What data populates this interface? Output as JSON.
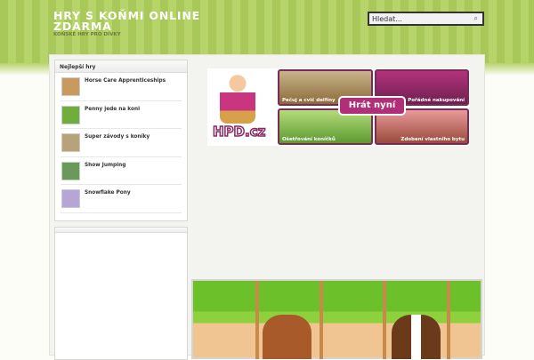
{
  "header": {
    "title": "HRY S KOŇMI ONLINE ZDARMA",
    "tagline": "KOŇSKÉ HRY PRO DÍVKY",
    "search_placeholder": "Hledat...",
    "search_icon": "search-icon"
  },
  "sidebar": {
    "widget_title": "Nejlepší hry",
    "items": [
      {
        "label": "Horse Care Apprenticeships",
        "color": "#c99a5e"
      },
      {
        "label": "Penny jede na koni",
        "color": "#6fae3c"
      },
      {
        "label": "Super závody s koníky",
        "color": "#b9a27a"
      },
      {
        "label": "Show Jumping",
        "color": "#6a9a5a"
      },
      {
        "label": "Snowflake Pony",
        "color": "#b6a6d8"
      }
    ]
  },
  "ad": {
    "logo": "HPD.cz",
    "cta": "Hrát nyní",
    "tiles": [
      "Pečuj a cvič delfíny",
      "Pořádné nakupování",
      "Ošetřování koníčků",
      "Zdobení vlastního bytu"
    ]
  }
}
